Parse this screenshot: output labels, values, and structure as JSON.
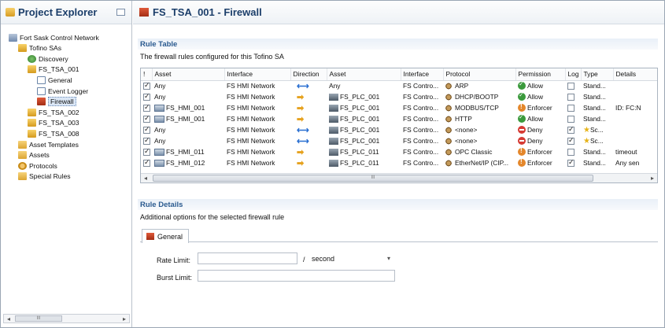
{
  "explorer": {
    "title": "Project Explorer",
    "tree": [
      {
        "label": "Fort Sask Control Network",
        "icon": "network-icon"
      },
      {
        "label": "Tofino SAs",
        "icon": "security-appliance-icon"
      },
      {
        "label": "Discovery",
        "icon": "discovery-icon"
      },
      {
        "label": "FS_TSA_001",
        "icon": "security-appliance-icon"
      },
      {
        "label": "General",
        "icon": "page-icon"
      },
      {
        "label": "Event Logger",
        "icon": "page-icon"
      },
      {
        "label": "Firewall",
        "icon": "firewall-icon"
      },
      {
        "label": "FS_TSA_002",
        "icon": "security-appliance-icon"
      },
      {
        "label": "FS_TSA_003",
        "icon": "security-appliance-icon"
      },
      {
        "label": "FS_TSA_008",
        "icon": "security-appliance-icon"
      },
      {
        "label": "Asset Templates",
        "icon": "folder-icon"
      },
      {
        "label": "Assets",
        "icon": "folder-icon"
      },
      {
        "label": "Protocols",
        "icon": "gear-icon"
      },
      {
        "label": "Special Rules",
        "icon": "folder-icon"
      }
    ],
    "scroll_thumb": "III"
  },
  "editor": {
    "title": "FS_TSA_001 - Firewall",
    "rule_table": {
      "heading": "Rule Table",
      "description": "The firewall rules configured for this Tofino SA",
      "columns": [
        "!",
        "Asset",
        "Interface",
        "Direction",
        "Asset",
        "Interface",
        "Protocol",
        "Permission",
        "Log",
        "Type",
        "Details"
      ],
      "rows": [
        {
          "checked": true,
          "asset1": "Any",
          "asset1_icon": "",
          "iface1": "FS HMI Network",
          "direction": "both",
          "asset2": "Any",
          "asset2_icon": "",
          "iface2": "FS Contro...",
          "protocol": "ARP",
          "permission": "Allow",
          "log": false,
          "type": "Stand...",
          "details": ""
        },
        {
          "checked": true,
          "asset1": "Any",
          "asset1_icon": "",
          "iface1": "FS HMI Network",
          "direction": "right",
          "asset2": "FS_PLC_001",
          "asset2_icon": "plc",
          "iface2": "FS Contro...",
          "protocol": "DHCP/BOOTP",
          "permission": "Allow",
          "log": false,
          "type": "Stand...",
          "details": ""
        },
        {
          "checked": true,
          "asset1": "FS_HMI_001",
          "asset1_icon": "hmi",
          "iface1": "FS HMI Network",
          "direction": "right",
          "asset2": "FS_PLC_001",
          "asset2_icon": "plc",
          "iface2": "FS Contro...",
          "protocol": "MODBUS/TCP",
          "permission": "Enforcer",
          "log": false,
          "type": "Stand...",
          "details": "ID: FC:N"
        },
        {
          "checked": true,
          "asset1": "FS_HMI_001",
          "asset1_icon": "hmi",
          "iface1": "FS HMI Network",
          "direction": "right",
          "asset2": "FS_PLC_001",
          "asset2_icon": "plc",
          "iface2": "FS Contro...",
          "protocol": "HTTP",
          "permission": "Allow",
          "log": false,
          "type": "Stand...",
          "details": ""
        },
        {
          "checked": true,
          "asset1": "Any",
          "asset1_icon": "",
          "iface1": "FS HMI Network",
          "direction": "both",
          "asset2": "FS_PLC_001",
          "asset2_icon": "plc",
          "iface2": "FS Contro...",
          "protocol": "<none>",
          "permission": "Deny",
          "log": true,
          "type": "Sc...",
          "type_star": true,
          "details": ""
        },
        {
          "checked": true,
          "asset1": "Any",
          "asset1_icon": "",
          "iface1": "FS HMI Network",
          "direction": "both",
          "asset2": "FS_PLC_001",
          "asset2_icon": "plc",
          "iface2": "FS Contro...",
          "protocol": "<none>",
          "permission": "Deny",
          "log": true,
          "type": "Sc...",
          "type_star": true,
          "details": ""
        },
        {
          "checked": true,
          "asset1": "FS_HMI_011",
          "asset1_icon": "hmi",
          "iface1": "FS HMI Network",
          "direction": "right",
          "asset2": "FS_PLC_011",
          "asset2_icon": "plc",
          "iface2": "FS Contro...",
          "protocol": "OPC Classic",
          "permission": "Enforcer",
          "log": false,
          "type": "Stand...",
          "details": "timeout"
        },
        {
          "checked": true,
          "asset1": "FS_HMI_012",
          "asset1_icon": "hmi",
          "iface1": "FS HMI Network",
          "direction": "right",
          "asset2": "FS_PLC_011",
          "asset2_icon": "plc",
          "iface2": "FS Contro...",
          "protocol": "EtherNet/IP (CIP...",
          "permission": "Enforcer",
          "log": true,
          "type": "Stand...",
          "details": "Any sen"
        }
      ],
      "scroll_thumb": "III"
    },
    "rule_details": {
      "heading": "Rule Details",
      "description": "Additional options for the selected firewall rule",
      "tab_general": "General",
      "rate_limit_label": "Rate Limit:",
      "rate_limit_value": "",
      "rate_separator": "/",
      "rate_unit": "second",
      "burst_limit_label": "Burst Limit:",
      "burst_limit_value": ""
    }
  }
}
